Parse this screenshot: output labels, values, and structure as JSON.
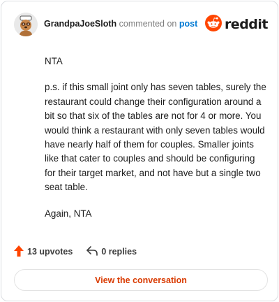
{
  "comment": {
    "username": "GrandpaJoeSloth",
    "action_text": "commented on",
    "post_link": "post",
    "paragraphs": [
      "NTA",
      "p.s. if this small joint only has seven tables, surely the restaurant could change their configuration around a bit so that six of the tables are not for 4 or more. You would think a restaurant with only seven tables would have nearly half of them for couples. Smaller joints like that cater to couples and should be configuring for their target market, and not have but a single two seat table.",
      "Again, NTA"
    ]
  },
  "brand": {
    "name": "reddit",
    "icon": "reddit-logo-icon",
    "color": "#ff4500"
  },
  "stats": {
    "upvotes": "13 upvotes",
    "replies": "0 replies",
    "upvote_icon": "upvote-arrow-icon",
    "reply_icon": "reply-arrow-icon",
    "upvote_color": "#ff4500"
  },
  "cta": {
    "label": "View the conversation",
    "color": "#d93a00"
  },
  "avatar": {
    "icon": "sloth-avatar-icon"
  }
}
